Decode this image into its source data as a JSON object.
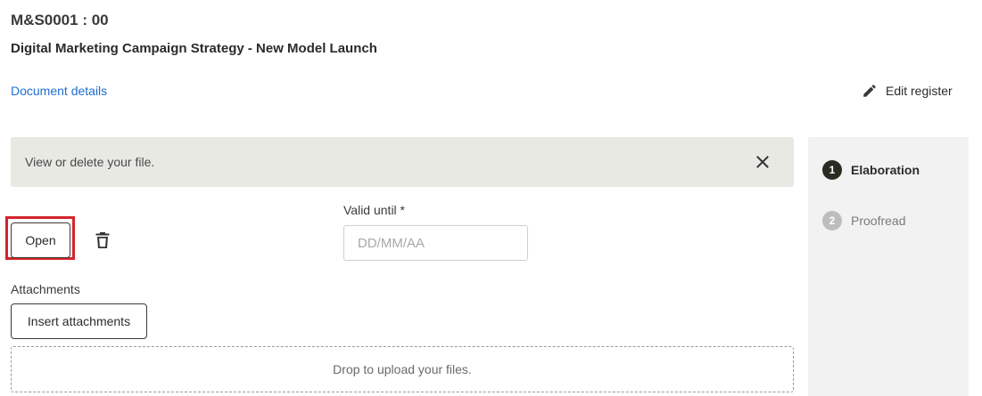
{
  "document": {
    "code": "M&S0001 : 00",
    "title": "Digital Marketing Campaign Strategy - New Model Launch",
    "details_link": "Document details",
    "edit_register": "Edit register"
  },
  "banner": {
    "text": "View or delete your file."
  },
  "file_actions": {
    "open_label": "Open"
  },
  "valid_until": {
    "label": "Valid until *",
    "placeholder": "DD/MM/AA",
    "value": ""
  },
  "attachments": {
    "label": "Attachments",
    "insert_label": "Insert attachments",
    "dropzone_text": "Drop to upload your files."
  },
  "workflow": {
    "steps": [
      {
        "number": "1",
        "label": "Elaboration",
        "active": true
      },
      {
        "number": "2",
        "label": "Proofread",
        "active": false
      }
    ]
  },
  "colors": {
    "link": "#1f6fd1",
    "banner_bg": "#e8e9e3",
    "highlight": "#d4242a",
    "active_step": "#2a2c22",
    "inactive_step": "#bdbdbd",
    "panel_bg": "#f2f2f2"
  },
  "icons": {
    "edit": "pencil-icon",
    "close": "close-icon",
    "delete": "trash-icon"
  }
}
